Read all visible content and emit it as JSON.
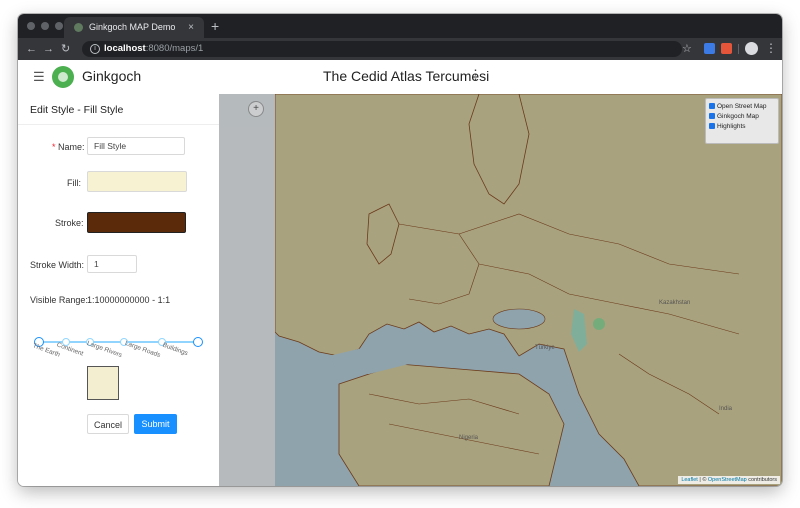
{
  "browser": {
    "tab_title": "Ginkgoch MAP Demo",
    "tab_close": "×",
    "new_tab": "+",
    "url_host": "localhost",
    "url_path": ":8080/maps/1",
    "info_icon": "i"
  },
  "app": {
    "brand": "Ginkgoch",
    "title": "The Cedid Atlas Tercumesi",
    "title_menu": "⋮"
  },
  "panel": {
    "title": "Edit Style - Fill Style",
    "name_required_mark": "*",
    "name_label": "Name",
    "name_value": "Fill Style",
    "fill_label": "Fill",
    "fill_color": "#f7f2d2",
    "stroke_label": "Stroke",
    "stroke_color": "#5a2a0a",
    "stroke_width_label": "Stroke Width",
    "stroke_width_value": "1",
    "visible_range_label": "Visible Range",
    "visible_range_value": "1:10000000000 - 1:1",
    "slider_marks": [
      "The Earth",
      "Continent",
      "Large Rivers",
      "Large Roads",
      "Buildings"
    ],
    "preview_fill": "#f3eed0",
    "cancel_label": "Cancel",
    "submit_label": "Submit",
    "accent": "#1890ff"
  },
  "map": {
    "layers": [
      "Open Street Map",
      "Ginkgoch Map",
      "Highlights"
    ],
    "attribution_leaflet": "Leaflet",
    "attribution_sep": " | © ",
    "attribution_osm": "OpenStreetMap",
    "attribution_tail": " contributors",
    "labels": [
      "Türkiye",
      "Kazakhstan",
      "India",
      "Nigeria"
    ]
  }
}
